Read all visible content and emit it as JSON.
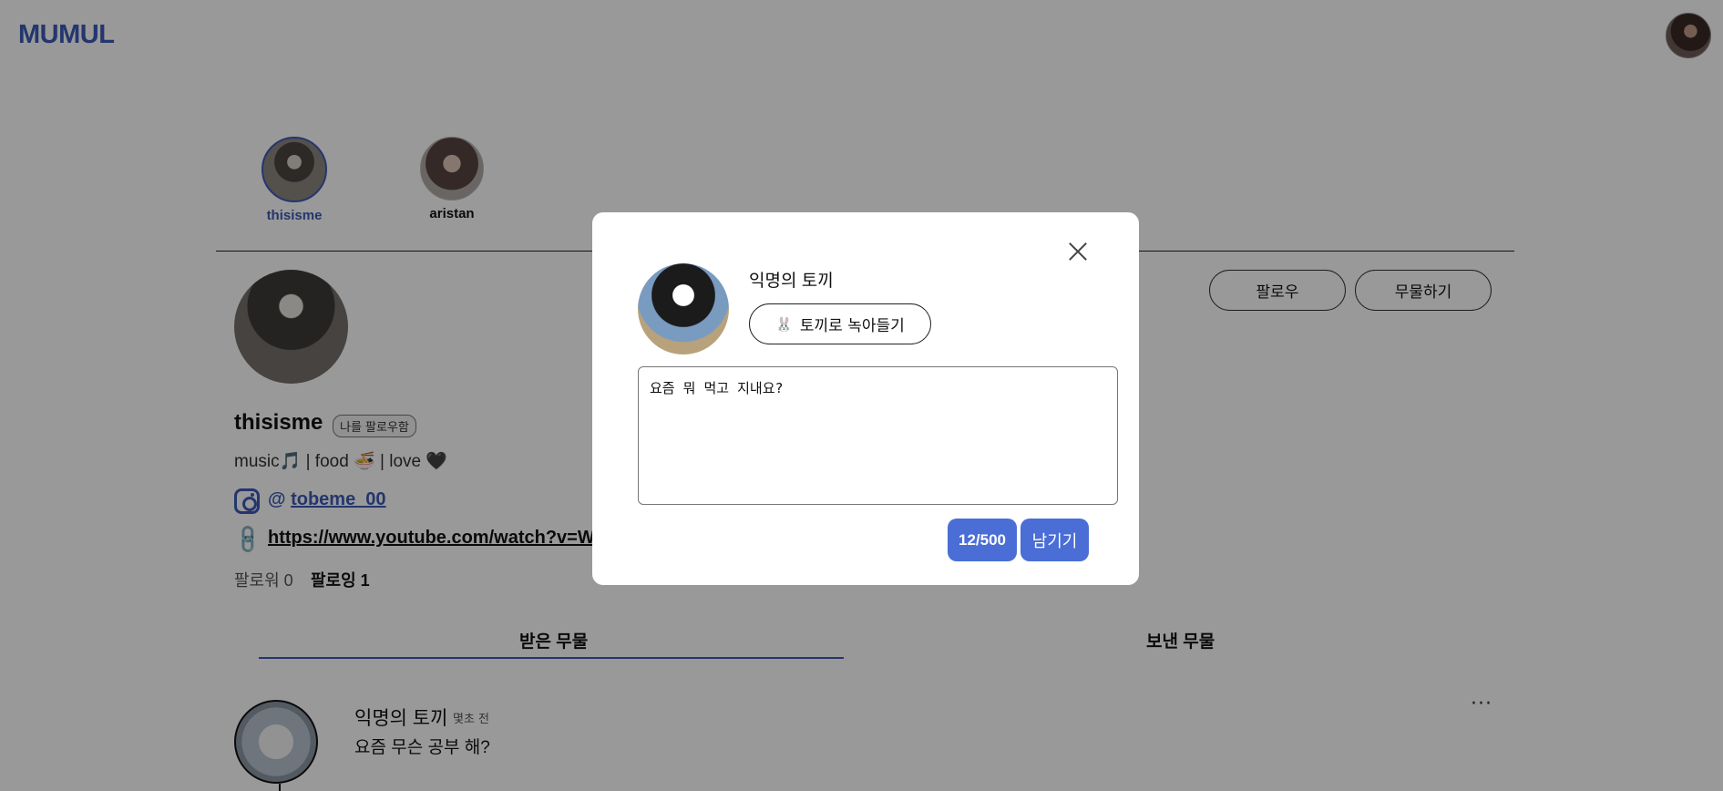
{
  "app": {
    "logo": "MUMUL"
  },
  "stories": [
    {
      "name": "thisisme"
    },
    {
      "name": "aristan"
    }
  ],
  "profile": {
    "username": "thisisme",
    "follows_me_badge": "나를 팔로우함",
    "bio_parts": {
      "music": "music",
      "music_emoji": "🎵",
      "sep1": " | food ",
      "food_emoji": "🍜",
      "sep2": " | love ",
      "love_emoji": "🖤"
    },
    "instagram": {
      "at": "@ ",
      "handle": "tobeme_00"
    },
    "link_url": "https://www.youtube.com/watch?v=WT",
    "followers_label": "팔로워 0",
    "following_label": "팔로잉 1",
    "follow_button": "팔로우",
    "ask_button": "무물하기"
  },
  "tabs": {
    "received": "받은 무물",
    "sent": "보낸 무물"
  },
  "feed": [
    {
      "author": "익명의 토끼",
      "time": "몇초 전",
      "text": "요즘 무슨 공부 해?"
    }
  ],
  "modal": {
    "sender_name": "익명의 토끼",
    "rabbit_button": "토끼로 녹아들기",
    "rabbit_emoji": "🐰",
    "message": "요즘 뭐 먹고 지내요?",
    "counter": "12/500",
    "submit": "남기기"
  },
  "colors": {
    "accent": "#3c5bb8",
    "button": "#4a6ed6",
    "overlay": "rgba(0,0,0,0.4)"
  }
}
